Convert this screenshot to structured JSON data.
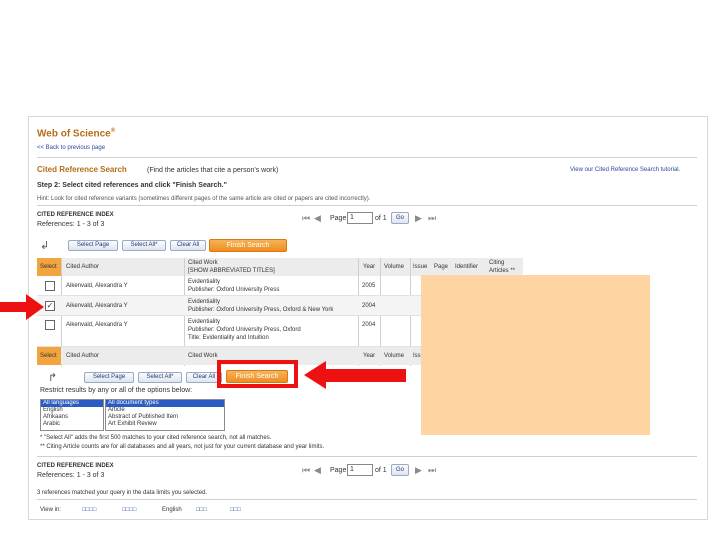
{
  "header": {
    "logo": "Web of Science",
    "logo_mark": "®",
    "back_link": "<< Back to previous page",
    "section_title": "Cited Reference Search",
    "section_subtitle": "(Find the articles that cite a person's work)",
    "tutorial_link": "View our Cited Reference Search tutorial."
  },
  "step": {
    "title": "Step 2: Select cited references and click \"Finish Search.\"",
    "hint": "Hint: Look for cited reference variants (sometimes different pages of the same article are cited or papers are cited incorrectly)."
  },
  "index_top": {
    "label": "CITED REFERENCE INDEX",
    "references_label": "References:",
    "references_range": "1 - 3 of 3",
    "page_label": "Page",
    "page_value": "1",
    "page_of": "of 1",
    "go_label": "Go"
  },
  "buttons": {
    "select_page": "Select Page",
    "select_all": "Select All*",
    "clear_all": "Clear All",
    "finish_search": "Finish Search"
  },
  "table": {
    "headers": {
      "select": "Select",
      "cited_author": "Cited Author",
      "cited_work": "Cited Work",
      "show_abbrev": "[SHOW ABBREVIATED TITLES]",
      "year": "Year",
      "volume": "Volume",
      "issue": "Issue",
      "page": "Page",
      "identifier": "Identifier",
      "citing_articles": "Citing Articles **"
    },
    "rows": [
      {
        "author": "Aikenvald, Alexandra Y",
        "work_line1": "Evidentiality",
        "work_line2": "Publisher: Oxford University Press",
        "work_line3": "",
        "year": "2005",
        "checked": ""
      },
      {
        "author": "Aikenvald, Alexandra Y",
        "work_line1": "Evidentiality",
        "work_line2": "Publisher: Oxford University Press, Oxford & New York",
        "work_line3": "",
        "year": "2004",
        "checked": "✓"
      },
      {
        "author": "Aikenvald, Alexandra Y",
        "work_line1": "Evidentiality",
        "work_line2": "Publisher: Oxford University Press, Oxford",
        "work_line3": "Title: Evidentiality and Intuition",
        "year": "2004",
        "checked": ""
      }
    ]
  },
  "restrict": {
    "label": "Restrict results by any or all of the options below:",
    "languages": [
      "All languages",
      "English",
      "Afrikaans",
      "Arabic"
    ],
    "doc_types": [
      "All document types",
      "Article",
      "Abstract of Published Item",
      "Art Exhibit Review"
    ]
  },
  "notes": {
    "note1": "* \"Select All\" adds the first 500 matches to your cited reference search, not all matches.",
    "note2": "** Citing Article counts are for all databases and all years, not just for your current database and year limits."
  },
  "index_bottom": {
    "label": "CITED REFERENCE INDEX",
    "references_label": "References:",
    "references_range": "1 - 3 of 3",
    "page_label": "Page",
    "page_value": "1",
    "page_of": "of 1",
    "go_label": "Go"
  },
  "footer": {
    "summary": "3 references matched your query in the data limits you selected.",
    "view_in": "View in:",
    "lang1": "□□□□",
    "lang2": "□□□□",
    "english": "English",
    "lang3": "□□□",
    "lang4": "□□□"
  },
  "colors": {
    "accent_orange": "#f2a53f",
    "highlight_overlay": "#fdd4a2",
    "annotation_red": "#ee1111",
    "link_blue": "#2a4aa0"
  },
  "icons": [
    "left-pointing-red-arrow-icon",
    "red-highlight-box",
    "return-arrow-icon",
    "pager-first-icon",
    "pager-prev-icon",
    "pager-next-icon",
    "pager-last-icon"
  ]
}
